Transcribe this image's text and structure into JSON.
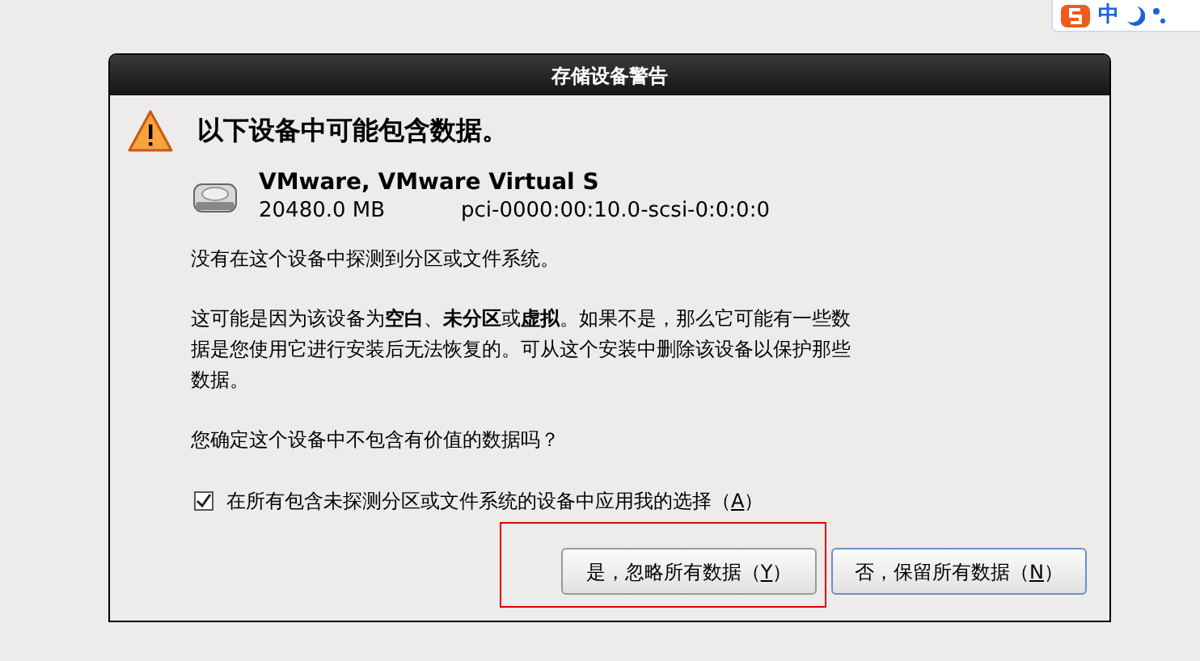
{
  "ime_bar": {
    "label": "中"
  },
  "dialog": {
    "title": "存储设备警告",
    "heading": "以下设备中可能包含数据。",
    "device": {
      "name": "VMware, VMware Virtual S",
      "size": "20480.0 MB",
      "path": "pci-0000:00:10.0-scsi-0:0:0:0"
    },
    "paragraphs": [
      "没有在这个设备中探测到分区或文件系统。",
      "这可能是因为该设备为**空白**、**未分区**或**虚拟**。如果不是，那么它可能有一些数据是您使用它进行安装后无法恢复的。可从这个安装中删除该设备以保护那些数据。",
      "您确定这个设备中不包含有价值的数据吗？"
    ],
    "checkbox": {
      "before": "在所有包含未探测分区或文件系统的设备中应用我的选择（",
      "mnemonic": "A",
      "after": "）",
      "checked": true
    },
    "buttons": [
      {
        "before": "是，忽略所有数据（",
        "mnemonic": "Y",
        "after": "）",
        "focused": false,
        "highlighted": true
      },
      {
        "before": "否，保留所有数据（",
        "mnemonic": "N",
        "after": "）",
        "focused": true,
        "highlighted": false
      }
    ]
  }
}
